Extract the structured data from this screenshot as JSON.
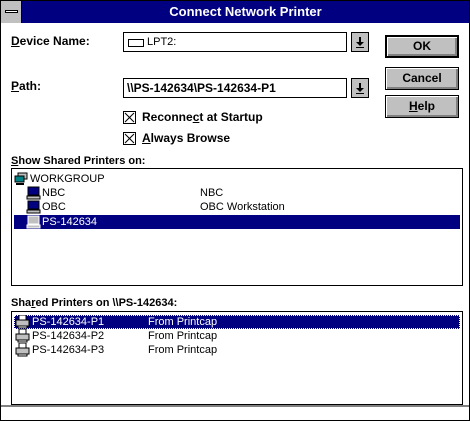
{
  "window": {
    "title": "Connect Network Printer"
  },
  "device": {
    "label_mnemonic": "D",
    "label_rest": "evice Name:",
    "value": "LPT2:"
  },
  "path": {
    "label_mnemonic": "P",
    "label_rest": "ath:",
    "value": "\\\\PS-142634\\PS-142634-P1"
  },
  "buttons": {
    "ok": "OK",
    "cancel": "Cancel",
    "help_mnemonic": "H",
    "help_rest": "elp"
  },
  "checkboxes": {
    "reconnect": {
      "pre": "Reconne",
      "mnemonic": "c",
      "post": "t at Startup",
      "checked": true
    },
    "browse": {
      "pre": "",
      "mnemonic": "A",
      "post": "lways Browse",
      "checked": true
    }
  },
  "show_shared": {
    "pre": "",
    "mnemonic": "S",
    "post": "how Shared Printers on:"
  },
  "tree": [
    {
      "name": "WORKGROUP",
      "desc": "",
      "icon": "workgroup-icon",
      "indent": 0,
      "selected": false
    },
    {
      "name": "NBC",
      "desc": "NBC",
      "icon": "computer-icon",
      "indent": 1,
      "selected": false
    },
    {
      "name": "OBC",
      "desc": "OBC Workstation",
      "icon": "computer-icon",
      "indent": 1,
      "selected": false
    },
    {
      "name": "PS-142634",
      "desc": "",
      "icon": "computer-icon",
      "indent": 1,
      "selected": true
    }
  ],
  "shared_on": {
    "pre": "Sha",
    "mnemonic": "r",
    "post": "ed Printers on \\\\PS-142634:"
  },
  "printers": [
    {
      "name": "PS-142634-P1",
      "desc": "From Printcap",
      "icon": "printer-icon",
      "selected": true
    },
    {
      "name": "PS-142634-P2",
      "desc": "From Printcap",
      "icon": "printer-icon",
      "selected": false
    },
    {
      "name": "PS-142634-P3",
      "desc": "From Printcap",
      "icon": "printer-icon",
      "selected": false
    }
  ],
  "colors": {
    "titlebar": "#000080",
    "selection": "#000080",
    "face": "#c0c0c0"
  }
}
